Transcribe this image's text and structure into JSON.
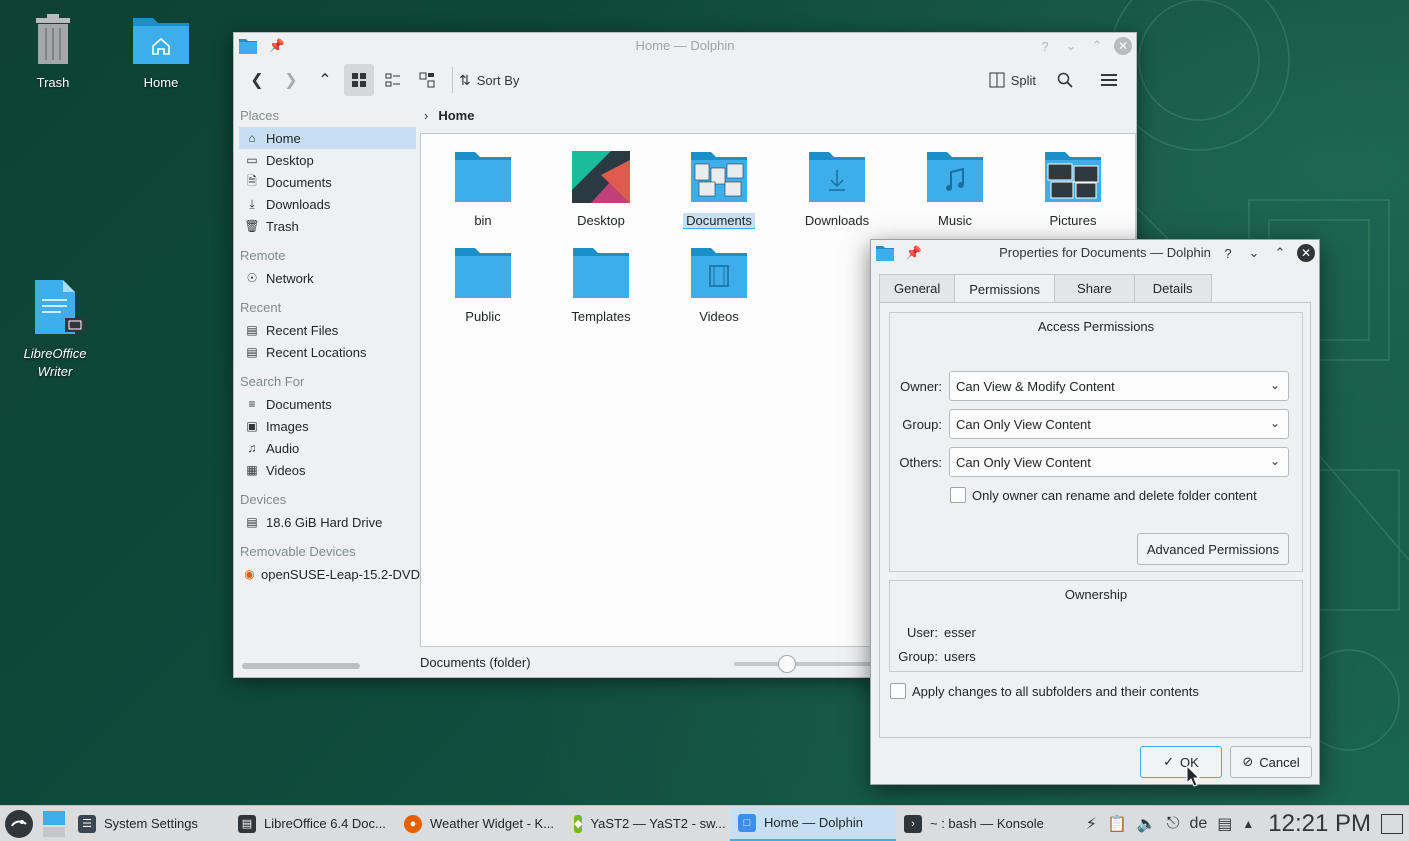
{
  "desktop": {
    "icons": [
      {
        "label": "Trash"
      },
      {
        "label": "Home"
      },
      {
        "label": "LibreOffice Writer"
      }
    ]
  },
  "dolphin": {
    "title": "Home — Dolphin",
    "toolbar": {
      "sort_label": "Sort By",
      "split_label": "Split"
    },
    "places": {
      "sections": [
        {
          "title": "Places",
          "items": [
            "Home",
            "Desktop",
            "Documents",
            "Downloads",
            "Trash"
          ]
        },
        {
          "title": "Remote",
          "items": [
            "Network"
          ]
        },
        {
          "title": "Recent",
          "items": [
            "Recent Files",
            "Recent Locations"
          ]
        },
        {
          "title": "Search For",
          "items": [
            "Documents",
            "Images",
            "Audio",
            "Videos"
          ]
        },
        {
          "title": "Devices",
          "items": [
            "18.6 GiB Hard Drive"
          ]
        },
        {
          "title": "Removable Devices",
          "items": [
            "openSUSE-Leap-15.2-DVD"
          ]
        }
      ]
    },
    "breadcrumb": "Home",
    "files": [
      "bin",
      "Desktop",
      "Documents",
      "Downloads",
      "Music",
      "Pictures",
      "Public",
      "Templates",
      "Videos"
    ],
    "selected_file": "Documents",
    "status": "Documents (folder)"
  },
  "properties": {
    "title": "Properties for Documents — Dolphin",
    "tabs": [
      "General",
      "Permissions",
      "Share",
      "Details"
    ],
    "active_tab": "Permissions",
    "access": {
      "title": "Access Permissions",
      "owner_label": "Owner:",
      "owner_value": "Can View & Modify Content",
      "group_label": "Group:",
      "group_value": "Can Only View Content",
      "others_label": "Others:",
      "others_value": "Can Only View Content",
      "only_owner_label": "Only owner can rename and delete folder content",
      "advanced_button": "Advanced Permissions"
    },
    "ownership": {
      "title": "Ownership",
      "user_label": "User:",
      "user_value": "esser",
      "group_label": "Group:",
      "group_value": "users"
    },
    "apply_subfolders_label": "Apply changes to all subfolders and their contents",
    "ok_label": "OK",
    "cancel_label": "Cancel"
  },
  "taskbar": {
    "tasks": [
      {
        "label": "System Settings",
        "color": "#3a4652"
      },
      {
        "label": "LibreOffice 6.4 Doc...",
        "color": "#31363b"
      },
      {
        "label": "Weather Widget - K...",
        "color": "#e66000"
      },
      {
        "label": "YaST2 — YaST2 - sw...",
        "color": "#73ba25"
      },
      {
        "label": "Home — Dolphin",
        "color": "#3d8ee9"
      },
      {
        "label": "~ : bash — Konsole",
        "color": "#31363b"
      }
    ],
    "keyboard_layout": "de",
    "clock": "12:21 PM"
  }
}
